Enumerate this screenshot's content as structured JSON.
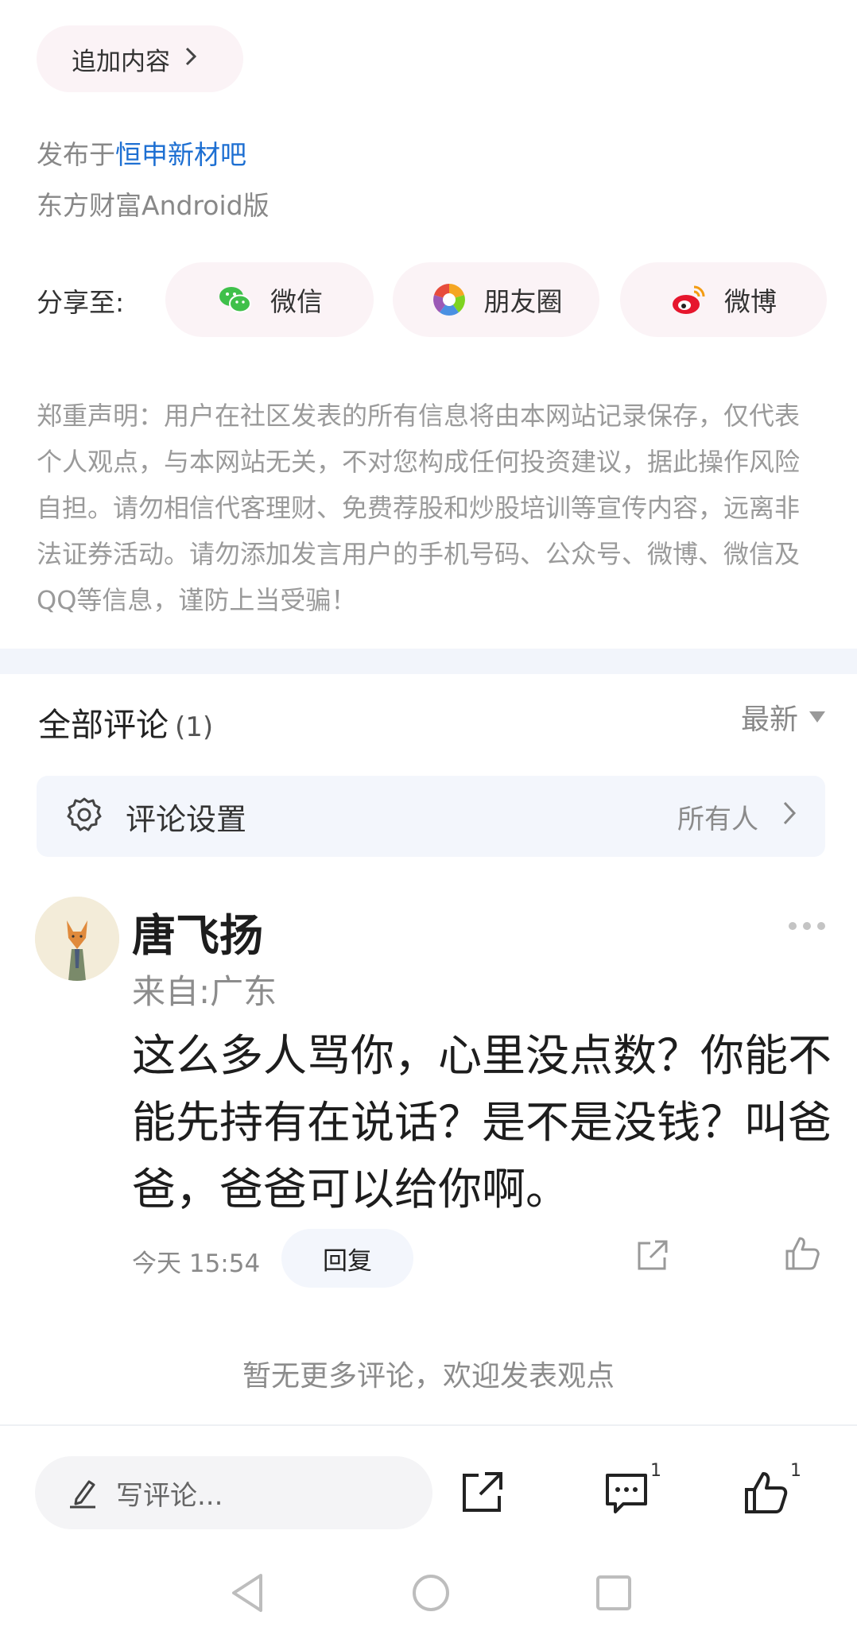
{
  "append": {
    "label": "追加内容"
  },
  "post_meta": {
    "posted_prefix": "发布于",
    "bar_name": "恒申新材吧",
    "client": "东方财富Android版"
  },
  "share": {
    "label": "分享至:",
    "targets": [
      {
        "label": "微信",
        "icon": "wechat-icon"
      },
      {
        "label": "朋友圈",
        "icon": "moments-icon"
      },
      {
        "label": "微博",
        "icon": "weibo-icon"
      }
    ]
  },
  "disclaimer": "郑重声明：用户在社区发表的所有信息将由本网站记录保存，仅代表个人观点，与本网站无关，不对您构成任何投资建议，据此操作风险自担。请勿相信代客理财、免费荐股和炒股培训等宣传内容，远离非法证券活动。请勿添加发言用户的手机号码、公众号、微博、微信及QQ等信息，谨防上当受骗！",
  "comments_header": {
    "title": "全部评论",
    "count": "(1)",
    "sort": "最新"
  },
  "comment_settings": {
    "label": "评论设置",
    "value": "所有人"
  },
  "comment": {
    "user": "唐飞扬",
    "location": "来自:广东",
    "text": "这么多人骂你，心里没点数？你能不能先持有在说话？是不是没钱？叫爸爸，爸爸可以给你啊。",
    "time": "今天 15:54",
    "reply_label": "回复"
  },
  "no_more": "暂无更多评论，欢迎发表观点",
  "bottom_bar": {
    "placeholder": "写评论...",
    "comment_count": "1",
    "like_count": "1"
  },
  "colors": {
    "link": "#1d6fd2",
    "pill_bg": "#fbf3f6",
    "setting_bg": "#f3f6fc"
  }
}
